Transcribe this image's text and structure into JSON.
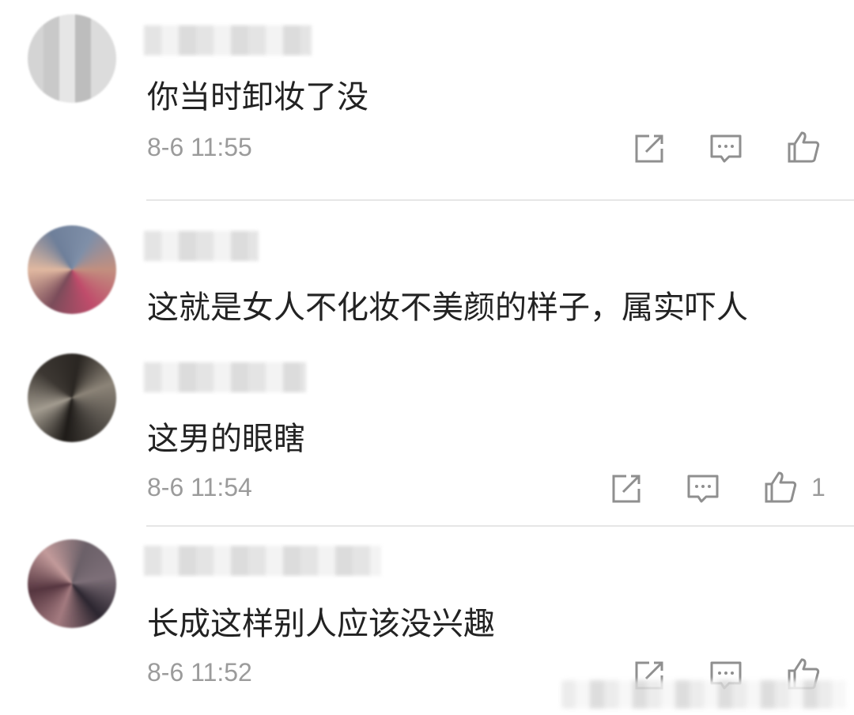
{
  "comments": [
    {
      "text": "你当时卸妆了没",
      "time": "8-6 11:55",
      "likes": ""
    },
    {
      "text": "这就是女人不化妆不美颜的样子，属实吓人",
      "time": "",
      "likes": ""
    },
    {
      "text": "这男的眼瞎",
      "time": "8-6 11:54",
      "likes": "1"
    },
    {
      "text": "长成这样别人应该没兴趣",
      "time": "8-6 11:52",
      "likes": ""
    }
  ],
  "icons": {
    "share": "share-icon",
    "reply": "comment-icon",
    "like": "thumbs-up-icon"
  },
  "colors": {
    "text": "#222222",
    "meta": "#9b9b9b",
    "icon": "#8f8f8f",
    "divider": "#e6e6e6"
  }
}
